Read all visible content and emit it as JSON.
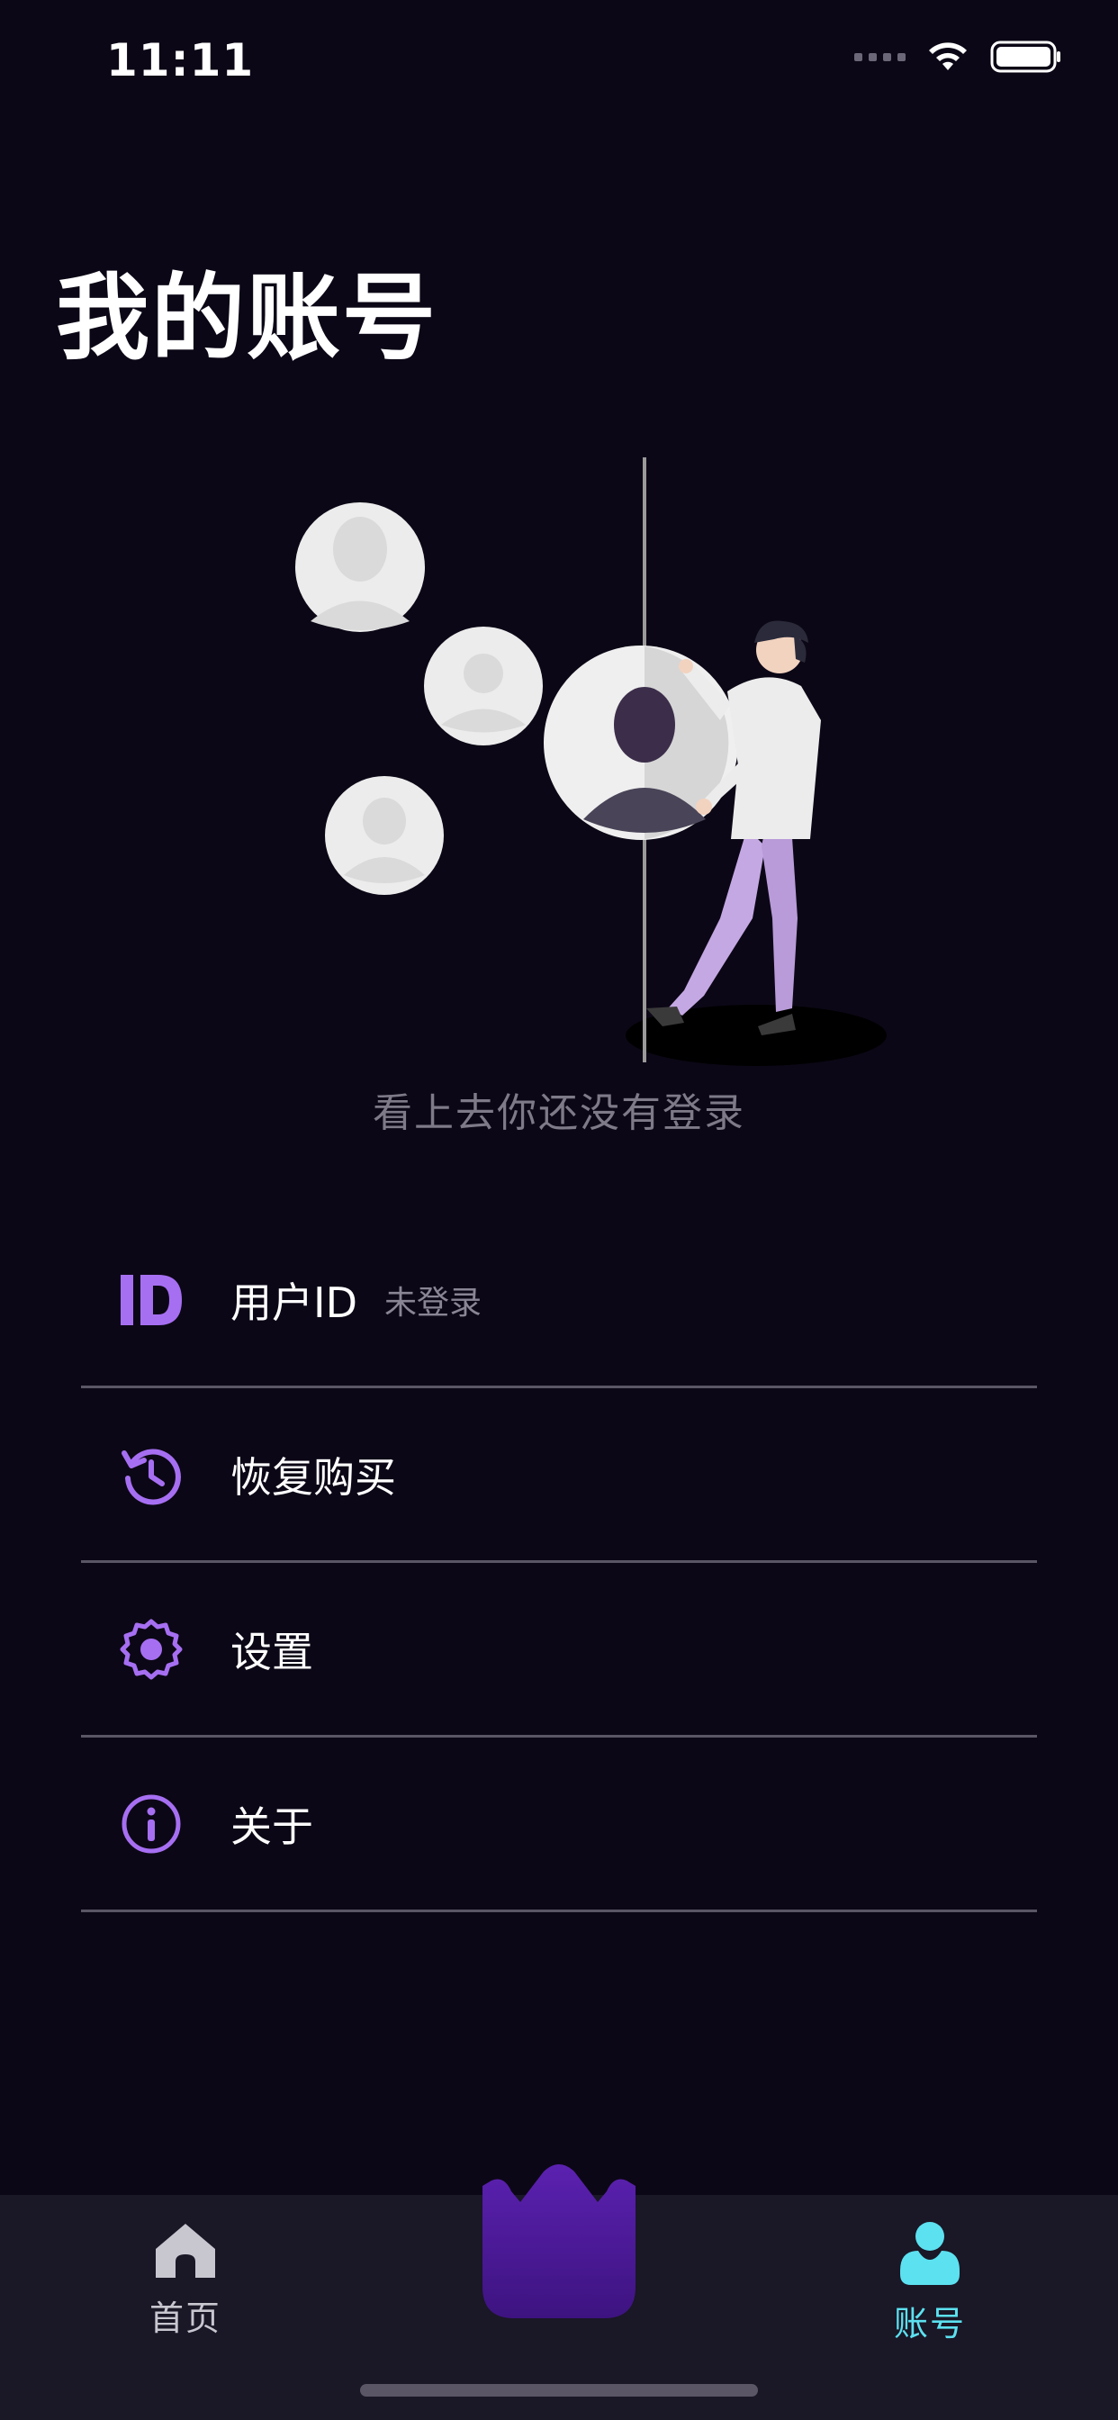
{
  "status_bar": {
    "time": "11:11"
  },
  "page": {
    "title": "我的账号",
    "empty_message": "看上去你还没有登录"
  },
  "menu": {
    "items": [
      {
        "label": "用户ID",
        "sub": "未登录",
        "icon": "id-icon"
      },
      {
        "label": "恢复购买",
        "icon": "restore-history-icon"
      },
      {
        "label": "设置",
        "icon": "gear-icon"
      },
      {
        "label": "关于",
        "icon": "info-icon"
      }
    ]
  },
  "tabbar": {
    "home_label": "首页",
    "account_label": "账号",
    "active": "account"
  },
  "colors": {
    "background": "#0c0716",
    "accent_purple": "#a66ff2",
    "active_tab": "#5ce1f0",
    "tabbar_bg": "#1a1726"
  }
}
